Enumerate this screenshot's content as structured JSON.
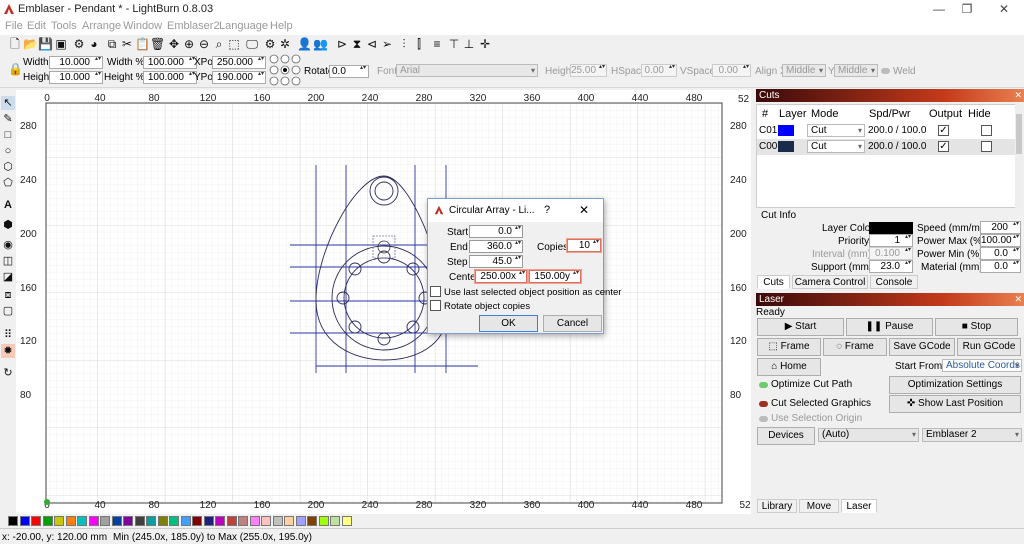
{
  "window": {
    "title": "Emblaser - Pendant * - LightBurn 0.8.03",
    "minimize": "—",
    "maximize": "❐",
    "close": "✕"
  },
  "menu": [
    "File",
    "Edit",
    "Tools",
    "Arrange",
    "Window",
    "Emblaser2",
    "Language",
    "Help"
  ],
  "propbar": {
    "width_label": "Width",
    "width_value": "10.000",
    "height_label": "Height",
    "height_value": "10.000",
    "width_pct_label": "Width %",
    "width_pct_value": "100.000",
    "height_pct_label": "Height %",
    "height_pct_value": "100.000",
    "xpos_label": "XPos",
    "xpos_value": "250.000",
    "ypos_label": "YPos",
    "ypos_value": "190.000",
    "rotate_label": "Rotate",
    "rotate_value": "0.0",
    "font_label": "Font",
    "font_value": "Arial",
    "fheight_label": "Height",
    "fheight_value": "25.00",
    "hspace_label": "HSpace",
    "hspace_value": "0.00",
    "vspace_label": "VSpace",
    "vspace_value": "0.00",
    "alignx_label": "Align X",
    "alignx_value": "Middle",
    "aligny_label": "Y",
    "aligny_value": "Middle",
    "weld_label": "Weld"
  },
  "ruler": {
    "top": [
      "0",
      "40",
      "80",
      "120",
      "160",
      "200",
      "240",
      "280",
      "320",
      "360",
      "400",
      "440",
      "480"
    ],
    "left": [
      "280",
      "240",
      "200",
      "160",
      "120",
      "80"
    ],
    "right": [
      "52",
      "280",
      "240",
      "200",
      "160",
      "120",
      "80"
    ],
    "bottom": [
      "0",
      "40",
      "80",
      "120",
      "160",
      "200",
      "240",
      "280",
      "320",
      "360",
      "400",
      "440",
      "480",
      "52"
    ]
  },
  "dialog": {
    "title": "Circular Array - Li...",
    "help": "?",
    "close": "✕",
    "start_label": "Start",
    "start_value": "0.0",
    "end_label": "End",
    "end_value": "360.0",
    "step_label": "Step",
    "step_value": "45.0",
    "copies_label": "Copies",
    "copies_value": "10",
    "center_label": "Center",
    "center_x": "250.00x",
    "center_y": "150.00y",
    "opt_last": "Use last selected object position as center",
    "opt_rotate": "Rotate object copies",
    "ok": "OK",
    "cancel": "Cancel"
  },
  "cuts": {
    "header": "Cuts",
    "columns": [
      "#",
      "Layer",
      "Mode",
      "Spd/Pwr",
      "Output",
      "Hide"
    ],
    "rows": [
      {
        "id": "C01",
        "color": "#0000ff",
        "mode": "Cut",
        "spdpwr": "200.0 / 100.0",
        "output": "✓"
      },
      {
        "id": "C00",
        "color": "#1a2a4a",
        "mode": "Cut",
        "spdpwr": "200.0 / 100.0",
        "output": "✓"
      }
    ]
  },
  "cutinfo": {
    "header": "Cut Info",
    "layer_color_label": "Layer Color",
    "speed_label": "Speed (mm/m)",
    "speed_value": "200",
    "priority_label": "Priority",
    "priority_value": "1",
    "pmax_label": "Power Max (%)",
    "pmax_value": "100.00",
    "interval_label": "Interval (mm)",
    "interval_value": "0.100",
    "pmin_label": "Power Min (%)",
    "pmin_value": "0.0",
    "support_label": "Support (mm)",
    "support_value": "23.0",
    "material_label": "Material (mm)",
    "material_value": "0.0"
  },
  "tabs_top": [
    "Cuts",
    "Camera Control",
    "Console"
  ],
  "laser": {
    "header": "Laser",
    "status": "Ready",
    "start": "Start",
    "pause": "Pause",
    "stop": "Stop",
    "frame1": "Frame",
    "frame2": "Frame",
    "save_gcode": "Save GCode",
    "run_gcode": "Run GCode",
    "home": "Home",
    "start_from_label": "Start From:",
    "start_from_value": "Absolute Coords",
    "opt_cut_path": "Optimize Cut Path",
    "opt_settings": "Optimization Settings",
    "cut_selected": "Cut Selected Graphics",
    "show_last": "Show Last Position",
    "use_origin": "Use Selection Origin",
    "devices": "Devices",
    "port_value": "(Auto)",
    "device_value": "Emblaser 2"
  },
  "tabs_bottom": [
    "Library",
    "Move",
    "Laser"
  ],
  "status": {
    "coords": "x: -20.00, y: 120.00 mm",
    "bounds": "Min (245.0x, 185.0y) to Max (255.0x, 195.0y)"
  },
  "palette": [
    "#000000",
    "#0000ff",
    "#ff0000",
    "#00a000",
    "#c8c800",
    "#ff8000",
    "#00c0c0",
    "#ff00ff",
    "#a0a0a0",
    "#0040a0",
    "#8000a0",
    "#404040",
    "#00a0a0",
    "#808000",
    "#00c080",
    "#40a0ff",
    "#800000",
    "#202080",
    "#c000c0",
    "#c04040",
    "#c08080",
    "#ff80ff",
    "#ffc0c0",
    "#c0c0c0",
    "#ffd0a0",
    "#a0a0ff",
    "#804000",
    "#a0ff00",
    "#c0e0a0",
    "#ffff80"
  ]
}
